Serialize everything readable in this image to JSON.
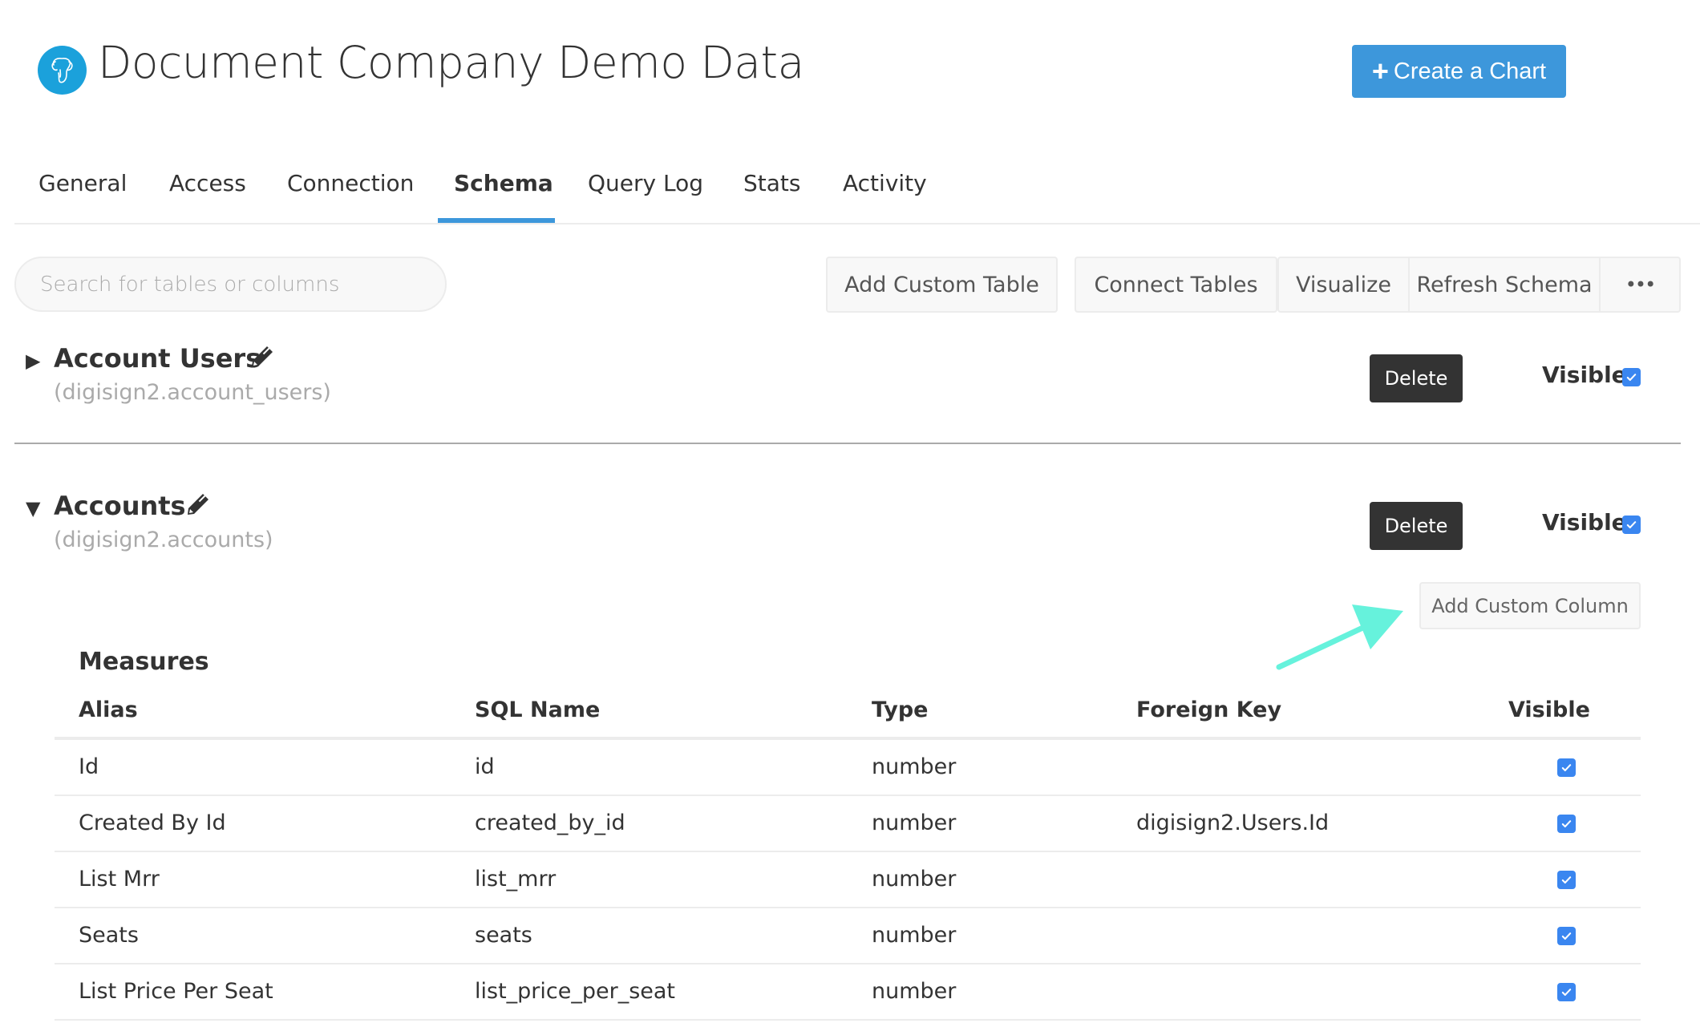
{
  "header": {
    "logo_icon": "postgresql-elephant-icon",
    "title": "Document Company Demo Data",
    "create_chart_label": "Create a Chart",
    "create_chart_icon": "plus-icon",
    "accent_color": "#3d97db"
  },
  "tabs": [
    {
      "label": "General",
      "active": false
    },
    {
      "label": "Access",
      "active": false
    },
    {
      "label": "Connection",
      "active": false
    },
    {
      "label": "Schema",
      "active": true
    },
    {
      "label": "Query Log",
      "active": false
    },
    {
      "label": "Stats",
      "active": false
    },
    {
      "label": "Activity",
      "active": false
    }
  ],
  "toolbar": {
    "search_placeholder": "Search for tables or columns",
    "search_value": "",
    "add_custom_table": "Add Custom Table",
    "connect_tables": "Connect Tables",
    "visualize": "Visualize",
    "refresh_schema": "Refresh Schema",
    "more": "•••"
  },
  "tables": [
    {
      "name": "Account Users",
      "sql_name": "(digisign2.account_users)",
      "expanded": false,
      "caret": "▶",
      "delete_label": "Delete",
      "visible_label": "Visible",
      "visible": true
    },
    {
      "name": "Accounts",
      "sql_name": "(digisign2.accounts)",
      "expanded": true,
      "caret": "▼",
      "delete_label": "Delete",
      "visible_label": "Visible",
      "visible": true,
      "add_custom_column": "Add Custom Column",
      "section_title": "Measures",
      "columns": [
        "Alias",
        "SQL Name",
        "Type",
        "Foreign Key",
        "Visible"
      ],
      "rows": [
        {
          "alias": "Id",
          "sql_name": "id",
          "type": "number",
          "foreign_key": "",
          "visible": true
        },
        {
          "alias": "Created By Id",
          "sql_name": "created_by_id",
          "type": "number",
          "foreign_key": "digisign2.Users.Id",
          "visible": true
        },
        {
          "alias": "List Mrr",
          "sql_name": "list_mrr",
          "type": "number",
          "foreign_key": "",
          "visible": true
        },
        {
          "alias": "Seats",
          "sql_name": "seats",
          "type": "number",
          "foreign_key": "",
          "visible": true
        },
        {
          "alias": "List Price Per Seat",
          "sql_name": "list_price_per_seat",
          "type": "number",
          "foreign_key": "",
          "visible": true
        }
      ]
    }
  ],
  "annotation": {
    "type": "arrow",
    "color": "#66f2dc",
    "points_to": "Add Custom Column"
  }
}
